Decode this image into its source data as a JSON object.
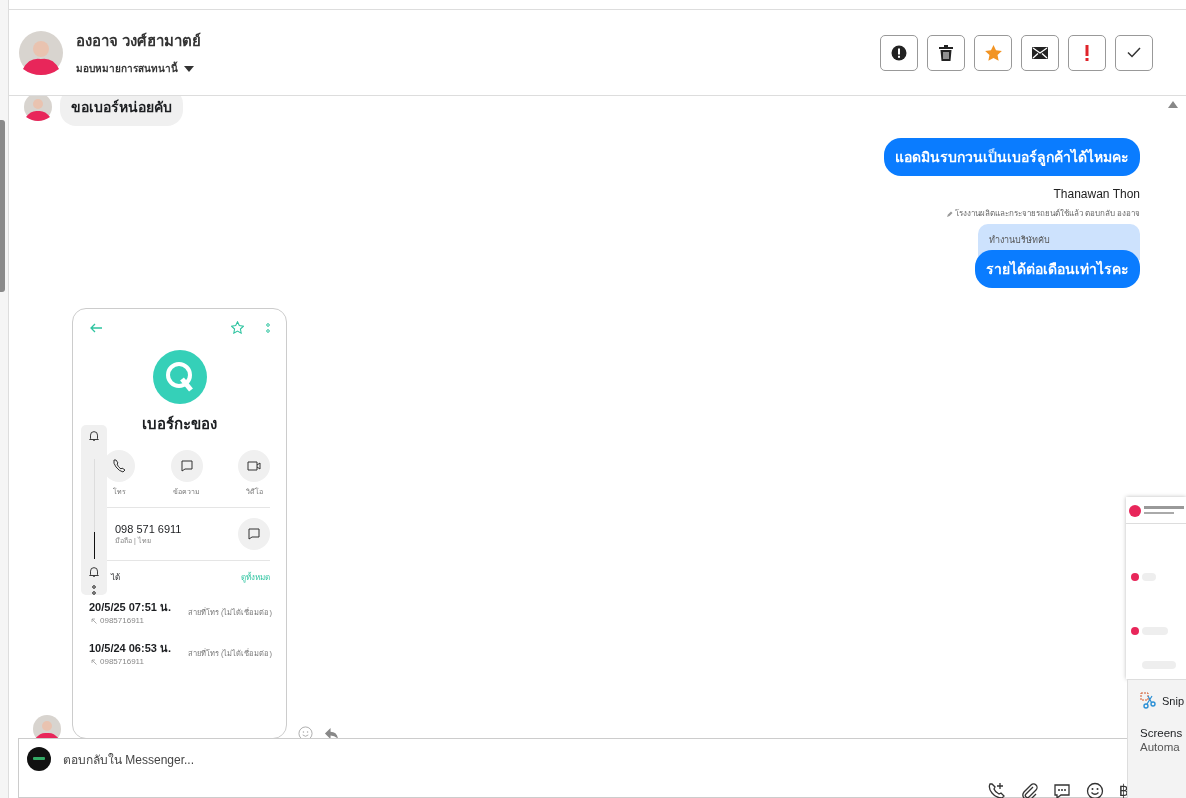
{
  "header": {
    "name": "องอาจ วงศ์ฮามาตย์",
    "assign_label": "มอบหมายการสนทนานี้",
    "actions": [
      {
        "kind": "alert"
      },
      {
        "kind": "trash"
      },
      {
        "kind": "star"
      },
      {
        "kind": "mail"
      },
      {
        "kind": "important"
      },
      {
        "kind": "done"
      }
    ]
  },
  "messages": [
    {
      "kind": "incoming",
      "text": "ขอเบอร์หน่อยคับ"
    },
    {
      "kind": "outgoing",
      "text": "แอดมินรบกวนเป็นเบอร์ลูกค้าได้ไหมคะ"
    },
    {
      "kind": "reply",
      "sender": "Thanawan Thon",
      "reply_note": "โรงงานผลิตและกระจายรถยนต์ใช้แล้ว ตอบกลับ องอาจ",
      "quoted": "ทำงานบริษัทคับ",
      "text": "รายได้ต่อเดือนเท่าไรคะ"
    },
    {
      "contact": {
        "name": "เบอร์กะของ",
        "actions": [
          "โทร",
          "ข้อความ",
          "วิดีโอ"
        ],
        "number": "098 571 6911",
        "number_type": "มือถือ | ไทย",
        "section": "ได้",
        "see_all": "ดูทั้งหมด",
        "volume": {
          "level": 0.27
        },
        "calls": [
          {
            "time": "20/5/25 07:51 น.",
            "number": "0985716911",
            "status": "สายที่โทร (ไม่ได้เชื่อมต่อ)"
          },
          {
            "time": "10/5/24 06:53 น.",
            "number": "0985716911",
            "status": "สายที่โทร (ไม่ได้เชื่อมต่อ)"
          }
        ]
      }
    }
  ],
  "composer": {
    "placeholder": "ตอบกลับใน Messenger...",
    "tools": [
      {
        "kind": "call"
      },
      {
        "kind": "attach"
      },
      {
        "kind": "chat"
      },
      {
        "kind": "emoji"
      },
      {
        "kind": "baht",
        "glyph": "฿"
      }
    ]
  },
  "toast": {
    "app": "Snip",
    "line1": "Screens",
    "line2": "Automa"
  }
}
